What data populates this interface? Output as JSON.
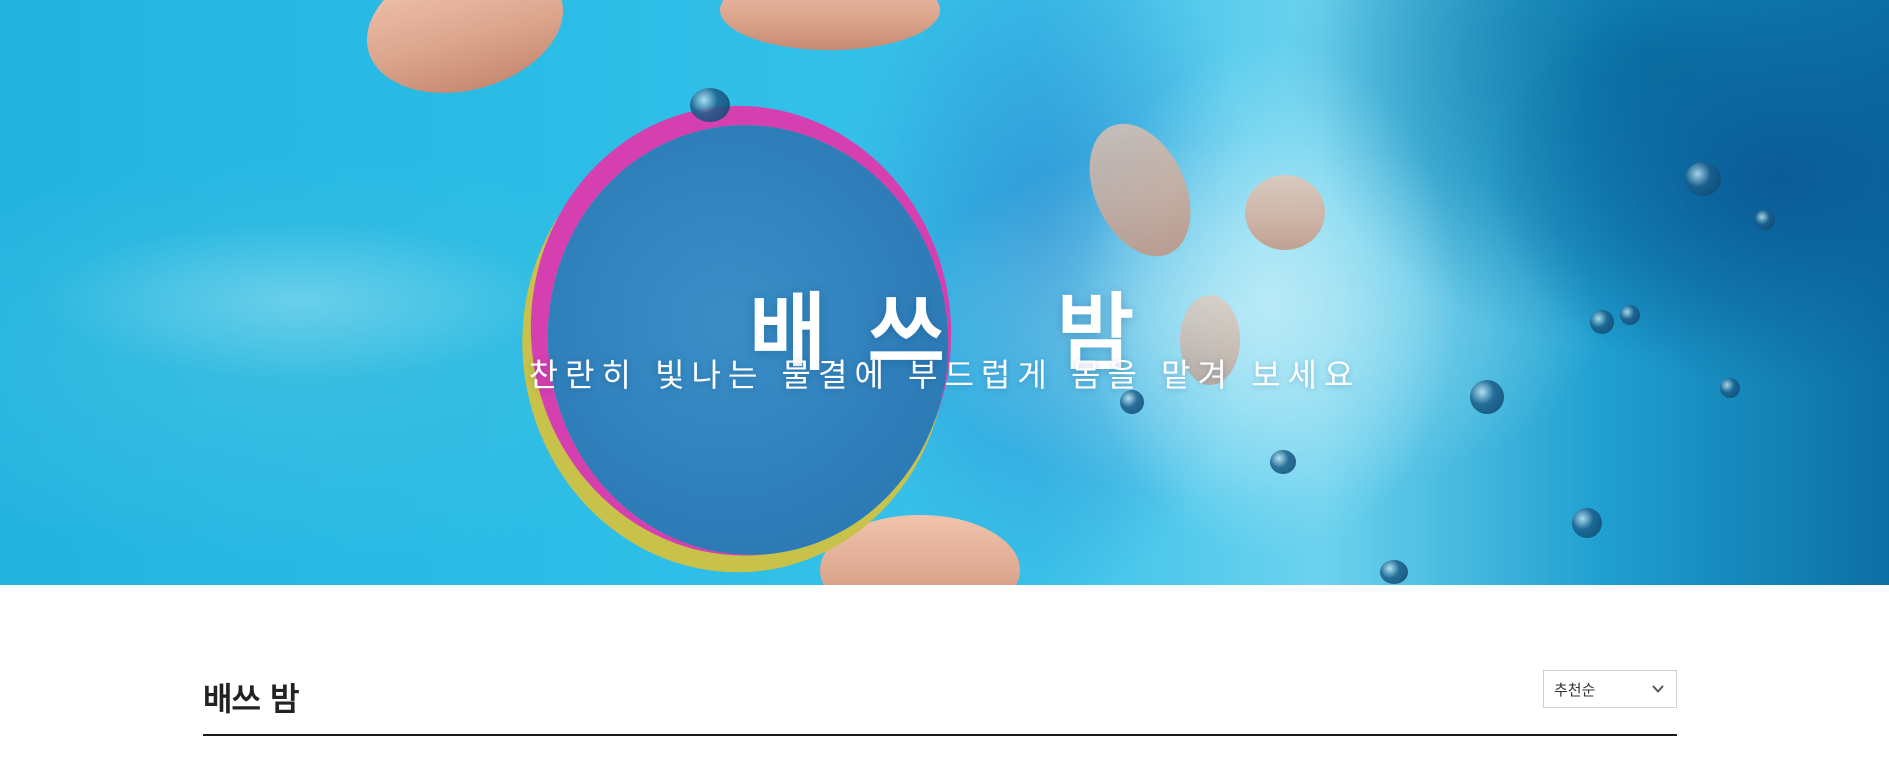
{
  "hero": {
    "title": "배 쓰   밤",
    "subtitle": "찬란히 빛나는 물결에 부드럽게 몸을 맡겨 보세요",
    "image_description_icon": "bath-bomb-foam-image"
  },
  "section": {
    "title": "배쓰 밤"
  },
  "sort": {
    "selected": "추천순",
    "icon": "chevron-down-icon"
  },
  "colors": {
    "accent": "#1a1a1a",
    "hero_text": "#ffffff",
    "water": "#2bbde6"
  }
}
